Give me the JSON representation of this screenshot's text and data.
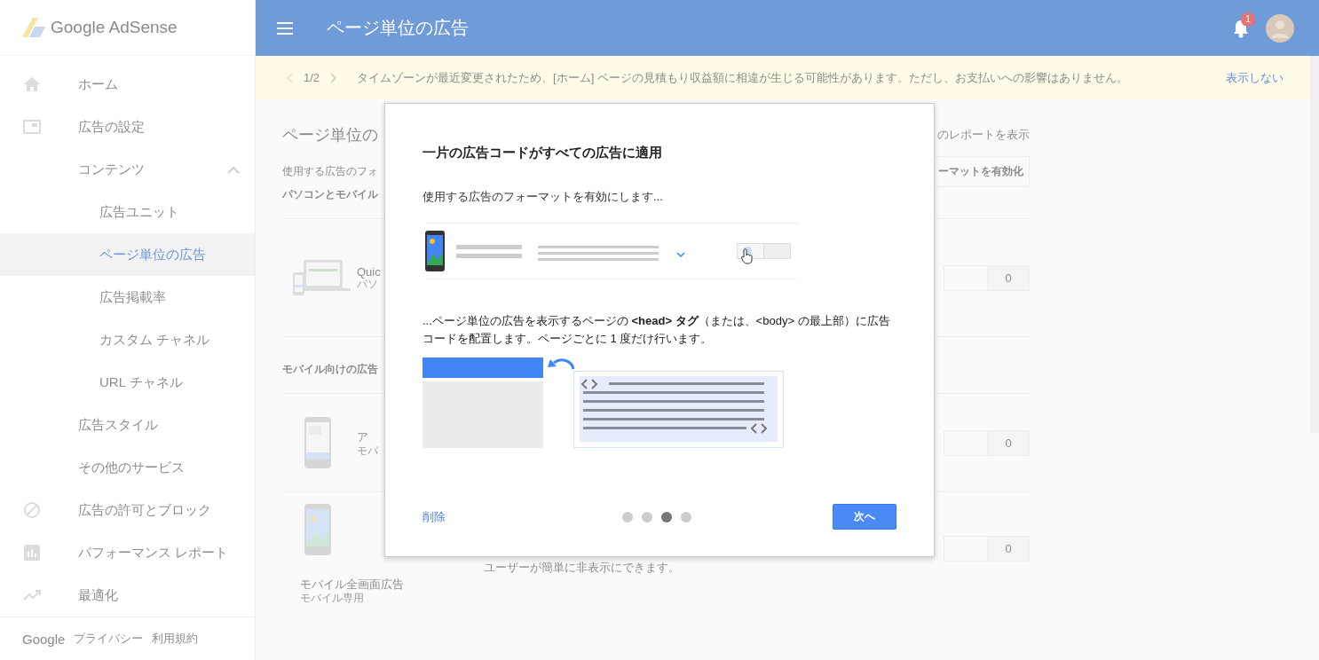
{
  "sidebar": {
    "logo": "Google AdSense",
    "items": [
      {
        "label": "ホーム",
        "selected": false
      },
      {
        "label": "広告の設定",
        "selected": false
      },
      {
        "label": "コンテンツ",
        "selected": false,
        "expanded": true,
        "children": [
          {
            "label": "広告ユニット",
            "selected": false
          },
          {
            "label": "ページ単位の広告",
            "selected": true
          },
          {
            "label": "広告掲載率",
            "selected": false
          },
          {
            "label": "カスタム チャネル",
            "selected": false
          },
          {
            "label": "URL チャネル",
            "selected": false
          }
        ]
      },
      {
        "label": "広告スタイル",
        "selected": false
      },
      {
        "label": "その他のサービス",
        "selected": false
      },
      {
        "label": "広告の許可とブロック",
        "selected": false
      },
      {
        "label": "パフォーマンス レポート",
        "selected": false
      },
      {
        "label": "最適化",
        "selected": false
      }
    ],
    "footer": {
      "brand": "Google",
      "links": [
        "プライバシー",
        "利用規約"
      ]
    }
  },
  "header": {
    "title": "ページ単位の広告",
    "notification_count": "1"
  },
  "notice": {
    "pager": "1/2",
    "message": "タイムゾーンが最近変更されたため、[ホーム] ページの見積もり収益額に相違が生じる可能性があります。ただし、お支払いへの影響はありません。",
    "dismiss": "表示しない"
  },
  "page": {
    "title": "ページ単位の",
    "report_link": "のレポートを表示",
    "subtitle": "使用する広告のフォ",
    "enable_button": "ーマットを有効化",
    "sections": [
      {
        "heading": "パソコンとモバイル",
        "formats": [
          {
            "kind": "inline",
            "name": "Quic",
            "note": "パソ",
            "value": "0"
          }
        ]
      },
      {
        "heading": "モバイル向けの広告",
        "formats": [
          {
            "kind": "inline",
            "name": "ア",
            "note": "モバ",
            "value": "0"
          },
          {
            "kind": "stacked",
            "name": "モバイル全画面広告",
            "note": "モバイル専用",
            "description": "ユーザーが簡単に非表示にできます。",
            "value": "0"
          }
        ]
      }
    ]
  },
  "modal": {
    "title": "一片の広告コードがすべての広告に適用",
    "intro": "使用する広告のフォーマットを有効にします...",
    "example_switch_on": false,
    "description": "...ページ単位の広告を表示するページの **<head> タグ**（または、<body> の最上部）に広告コードを配置します。ページごとに 1 度だけ行います。",
    "delete_link": "削除",
    "steps": [
      {
        "selected": false
      },
      {
        "selected": false
      },
      {
        "selected": true
      },
      {
        "selected": false
      }
    ],
    "next_button": "次へ"
  }
}
